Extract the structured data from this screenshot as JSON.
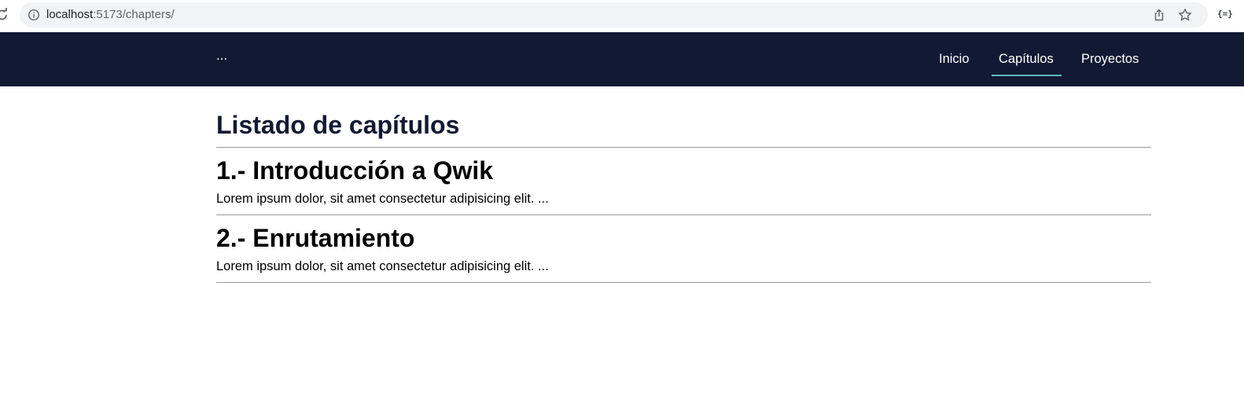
{
  "browser": {
    "url_host": "localhost",
    "url_path": ":5173/chapters/"
  },
  "nav": {
    "brand": "...",
    "items": [
      {
        "label": "Inicio",
        "active": false
      },
      {
        "label": "Capítulos",
        "active": true
      },
      {
        "label": "Proyectos",
        "active": false
      }
    ],
    "background": "#121a33",
    "accent": "#5fb6bd"
  },
  "main": {
    "title": "Listado de capítulos",
    "chapters": [
      {
        "title": "1.- Introducción a Qwik",
        "description": "Lorem ipsum dolor, sit amet consectetur adipisicing elit. ..."
      },
      {
        "title": "2.- Enrutamiento",
        "description": "Lorem ipsum dolor, sit amet consectetur adipisicing elit. ..."
      }
    ]
  }
}
